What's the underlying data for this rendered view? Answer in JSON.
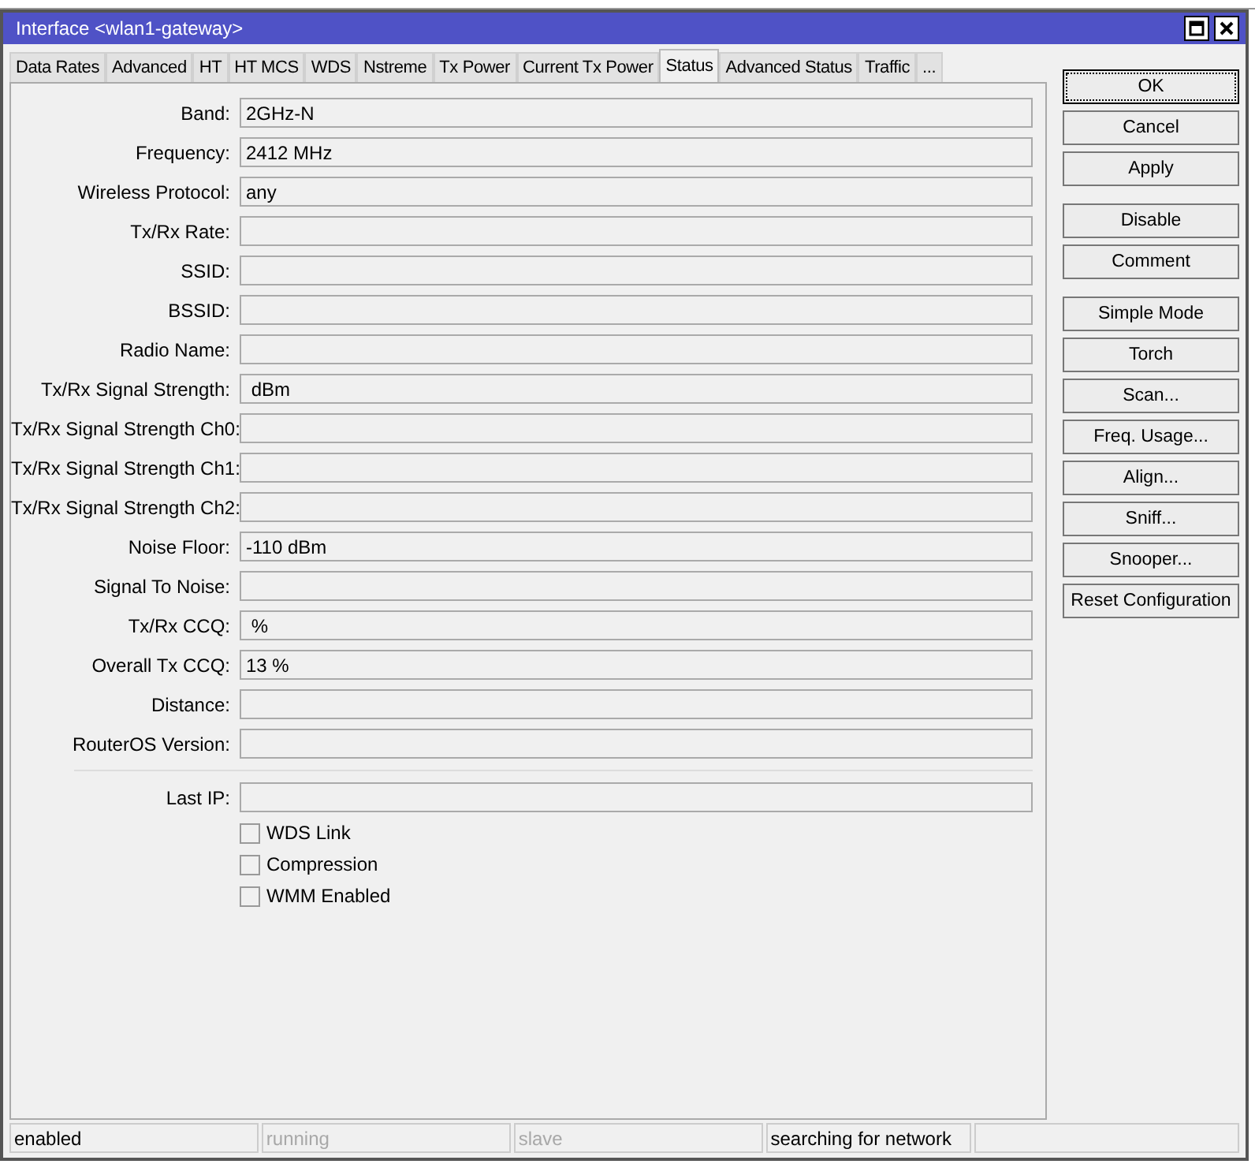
{
  "window": {
    "title": "Interface <wlan1-gateway>"
  },
  "tabs": [
    {
      "label": "Data Rates",
      "selected": false
    },
    {
      "label": "Advanced",
      "selected": false
    },
    {
      "label": "HT",
      "selected": false
    },
    {
      "label": "HT MCS",
      "selected": false
    },
    {
      "label": "WDS",
      "selected": false
    },
    {
      "label": "Nstreme",
      "selected": false
    },
    {
      "label": "Tx Power",
      "selected": false
    },
    {
      "label": "Current Tx Power",
      "selected": false
    },
    {
      "label": "Status",
      "selected": true
    },
    {
      "label": "Advanced Status",
      "selected": false
    },
    {
      "label": "Traffic",
      "selected": false
    },
    {
      "label": "...",
      "selected": false
    }
  ],
  "fields": [
    {
      "label": "Band:",
      "value": "2GHz-N"
    },
    {
      "label": "Frequency:",
      "value": "2412 MHz"
    },
    {
      "label": "Wireless Protocol:",
      "value": "any"
    },
    {
      "label": "Tx/Rx Rate:"
    },
    {
      "label": "SSID:"
    },
    {
      "label": "BSSID:"
    },
    {
      "label": "Radio Name:"
    },
    {
      "label": "Tx/Rx Signal Strength:",
      "value": " dBm"
    },
    {
      "label": "Tx/Rx Signal Strength Ch0:"
    },
    {
      "label": "Tx/Rx Signal Strength Ch1:"
    },
    {
      "label": "Tx/Rx Signal Strength Ch2:"
    },
    {
      "label": "Noise Floor:",
      "value": "-110 dBm"
    },
    {
      "label": "Signal To Noise:"
    },
    {
      "label": "Tx/Rx CCQ:",
      "value": " %"
    },
    {
      "label": "Overall Tx CCQ:",
      "value": "13 %"
    },
    {
      "label": "Distance:"
    },
    {
      "label": "RouterOS Version:"
    }
  ],
  "last_ip": {
    "label": "Last IP:"
  },
  "checkboxes": [
    {
      "label": "WDS Link",
      "checked": false
    },
    {
      "label": "Compression",
      "checked": false
    },
    {
      "label": "WMM Enabled",
      "checked": false
    }
  ],
  "button_groups": [
    [
      {
        "label": "OK",
        "focused": true
      },
      {
        "label": "Cancel",
        "focused": false
      },
      {
        "label": "Apply",
        "focused": false
      }
    ],
    [
      {
        "label": "Disable",
        "focused": false
      },
      {
        "label": "Comment",
        "focused": false
      }
    ],
    [
      {
        "label": "Simple Mode",
        "focused": false
      },
      {
        "label": "Torch",
        "focused": false
      },
      {
        "label": "Scan...",
        "focused": false
      },
      {
        "label": "Freq. Usage...",
        "focused": false
      },
      {
        "label": "Align...",
        "focused": false
      },
      {
        "label": "Sniff...",
        "focused": false
      },
      {
        "label": "Snooper...",
        "focused": false
      },
      {
        "label": "Reset Configuration",
        "focused": false
      }
    ]
  ],
  "status_bar": [
    {
      "text": "enabled",
      "disabled": false
    },
    {
      "text": "running",
      "disabled": true
    },
    {
      "text": "slave",
      "disabled": true
    },
    {
      "text": "searching for network",
      "disabled": false
    }
  ]
}
